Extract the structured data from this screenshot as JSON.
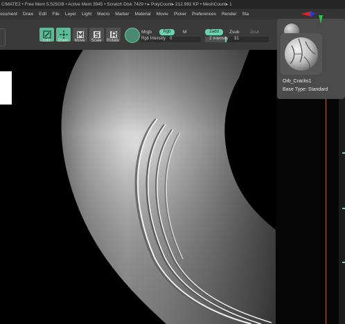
{
  "statusbar": {
    "text": "CIMATE2 • Free Mem 5.525GB • Active Mem 3945 • Scratch Disk 7429 • ▸ PolyCount▸ 212.992 KP • MeshCount▸ 1"
  },
  "menubar": {
    "items": [
      "ocument",
      "Draw",
      "Edit",
      "File",
      "Layer",
      "Light",
      "Macro",
      "Marker",
      "Material",
      "Movie",
      "Picker",
      "Preferences",
      "Render",
      "Sta"
    ]
  },
  "toolbar": {
    "tools": [
      {
        "label": "Edit",
        "active": true,
        "icon": "edit-icon"
      },
      {
        "label": "Draw",
        "active": true,
        "icon": "draw-icon"
      },
      {
        "label": "Move",
        "active": false,
        "icon": "move-icon"
      },
      {
        "label": "Scale",
        "active": false,
        "icon": "scale-icon"
      },
      {
        "label": "Rotate",
        "active": false,
        "icon": "rotate-icon"
      }
    ],
    "mrgb": "Mrgb",
    "rgb": "Rgb",
    "m": "M",
    "rgb_intensity_label": "Rgb Intensity",
    "rgb_intensity_value": "0",
    "rgb_intensity": 0,
    "zadd": "Zadd",
    "zsub": "Zsub",
    "zcut": "Zcut",
    "z_intensity_label": "Z Intensity",
    "z_intensity_value": "31",
    "z_intensity": 0.31
  },
  "brush_popup": {
    "name": "Orb_Cracks1",
    "base_type": "Base Type: Standard"
  },
  "colors": {
    "accent": "#6dd1ad",
    "toolbar_bg": "#3a3a3a",
    "popup_bg": "#4b4b4b"
  }
}
